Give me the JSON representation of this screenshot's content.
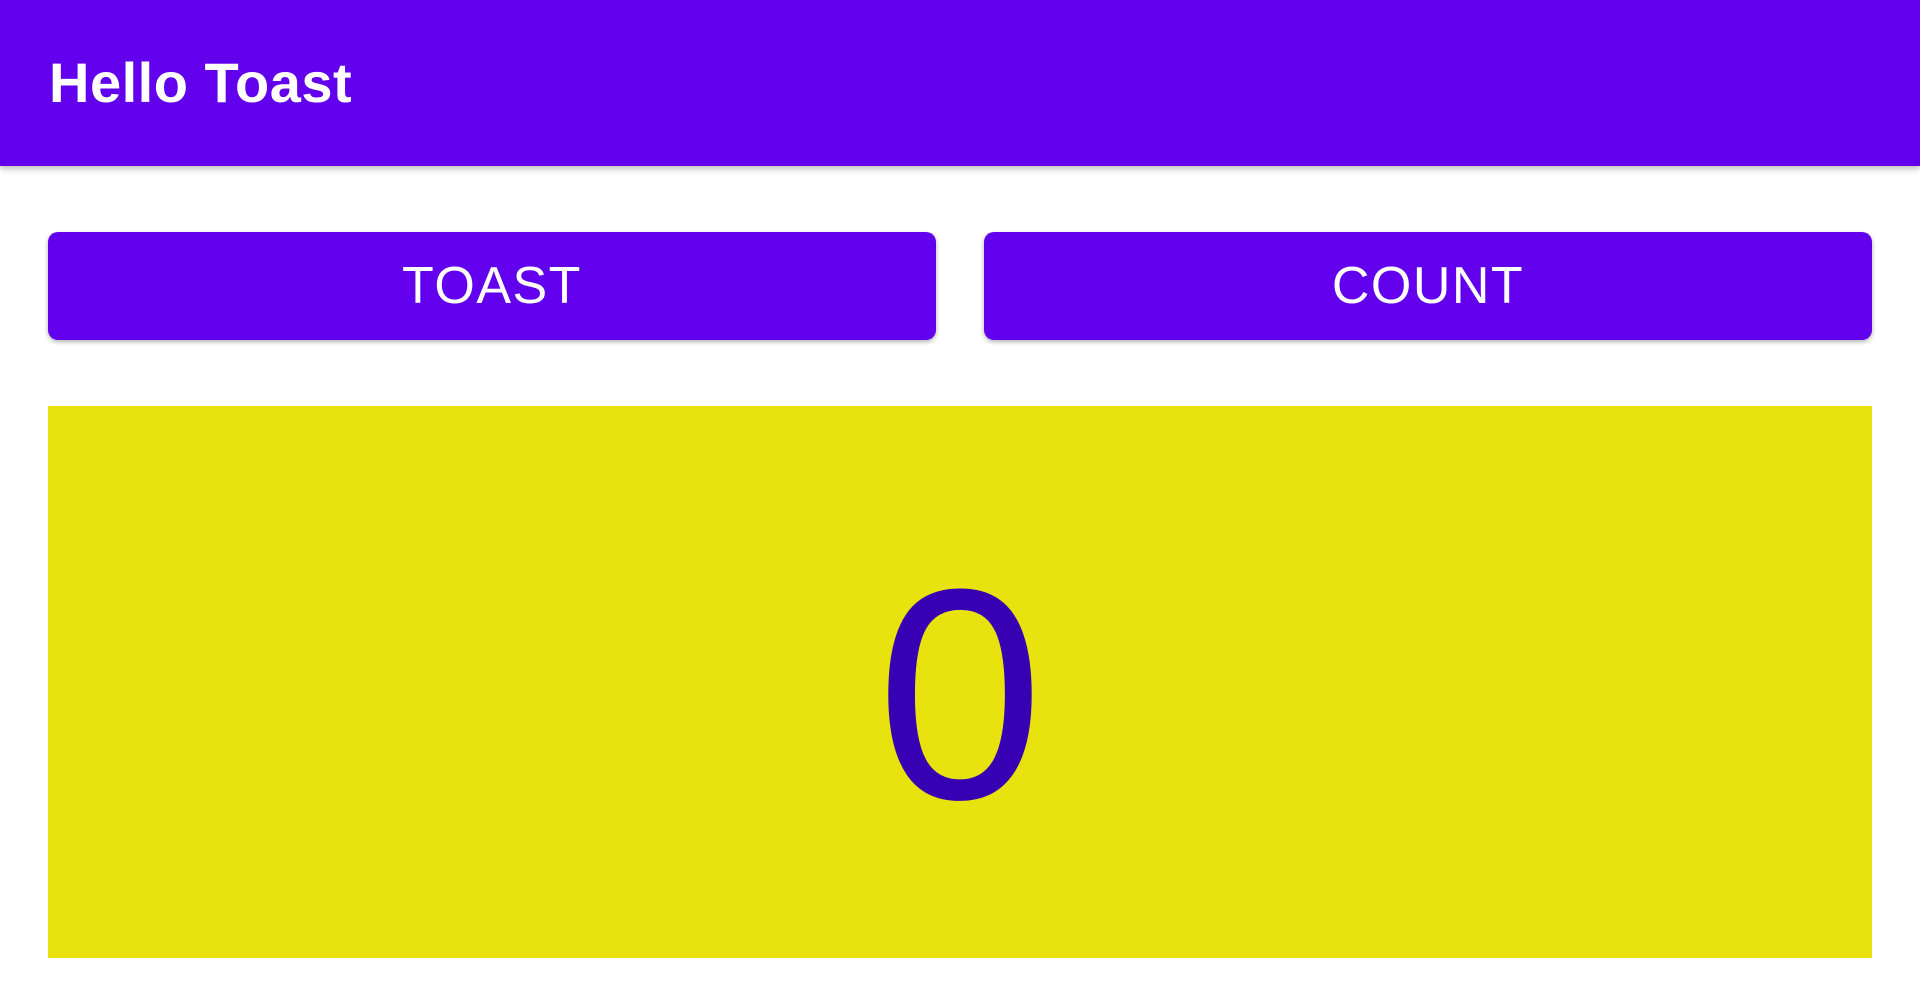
{
  "app_bar": {
    "title": "Hello Toast"
  },
  "buttons": {
    "toast_label": "TOAST",
    "count_label": "COUNT"
  },
  "counter": {
    "value": "0"
  },
  "colors": {
    "primary": "#6200EE",
    "primary_dark": "#3700B3",
    "panel_background": "#E8E30E",
    "on_primary": "#FFFFFF",
    "background": "#FFFFFF"
  }
}
